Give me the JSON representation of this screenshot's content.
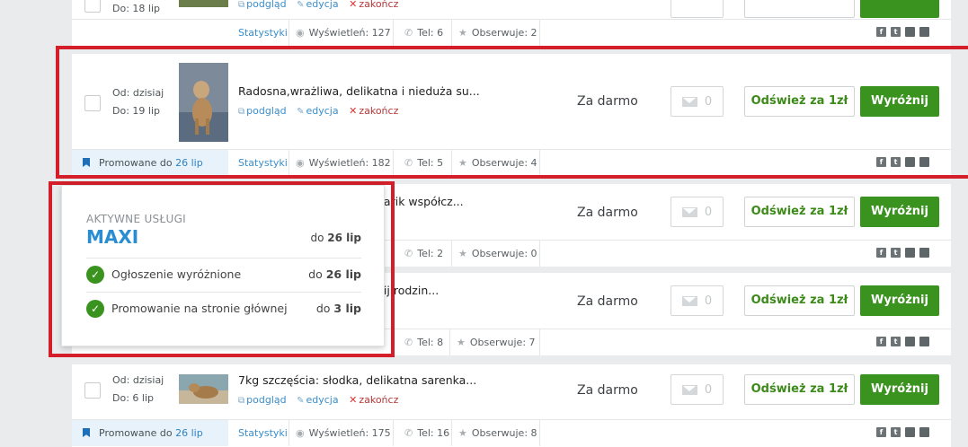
{
  "listings": [
    {
      "dates": {
        "from": "",
        "to": "Do: 18 lip"
      },
      "actions": {
        "preview": "podgląd",
        "edit": "edycja",
        "end": "zakończ"
      },
      "stats": {
        "link": "Statystyki",
        "views": "Wyświetleń: 127",
        "phone": "Tel: 6",
        "watch": "Obserwuje: 2"
      }
    },
    {
      "dates": {
        "from": "Od: dzisiaj",
        "to": "Do: 19 lip"
      },
      "title": "Radosna,wrażliwa, delikatna i nieduża su...",
      "actions": {
        "preview": "podgląd",
        "edit": "edycja",
        "end": "zakończ"
      },
      "price": "Za darmo",
      "messages": "0",
      "refresh": "Odśwież za 1zł",
      "feature": "Wyróżnij",
      "promo": {
        "label": "Promowane do",
        "date": "26 lip"
      },
      "stats": {
        "link": "Statystyki",
        "views": "Wyświetleń: 182",
        "phone": "Tel: 5",
        "watch": "Obserwuje: 4"
      }
    },
    {
      "title": "...arik współcz...",
      "price": "Za darmo",
      "messages": "0",
      "refresh": "Odśwież za 1zł",
      "feature": "Wyróżnij",
      "stats": {
        "phone": "Tel: 2",
        "watch": "Obserwuje: 0"
      }
    },
    {
      "title": "...ij rodzin...",
      "price": "Za darmo",
      "messages": "0",
      "refresh": "Odśwież za 1zł",
      "feature": "Wyróżnij",
      "stats": {
        "phone": "Tel: 8",
        "watch": "Obserwuje: 7"
      }
    },
    {
      "dates": {
        "from": "Od: dzisiaj",
        "to": "Do: 6 lip"
      },
      "title": "7kg szczęścia: słodka, delikatna sarenka...",
      "actions": {
        "preview": "podgląd",
        "edit": "edycja",
        "end": "zakończ"
      },
      "price": "Za darmo",
      "messages": "0",
      "refresh": "Odśwież za 1zł",
      "feature": "Wyróżnij",
      "promo": {
        "label": "Promowane do",
        "date": "26 lip"
      },
      "stats": {
        "link": "Statystyki",
        "views": "Wyświetleń: 175",
        "phone": "Tel: 16",
        "watch": "Obserwuje: 8"
      }
    }
  ],
  "popup": {
    "heading": "AKTYWNE USŁUGI",
    "package": "MAXI",
    "package_prefix": "do",
    "package_date": "26 lip",
    "services": [
      {
        "label": "Ogłoszenie wyróżnione",
        "prefix": "do",
        "date": "26 lip"
      },
      {
        "label": "Promowanie na stronie głównej",
        "prefix": "do",
        "date": "3 lip"
      }
    ]
  },
  "colors": {
    "accent_green": "#3a921f",
    "link_blue": "#3a8ecb",
    "highlight_red": "#d41f2a"
  }
}
